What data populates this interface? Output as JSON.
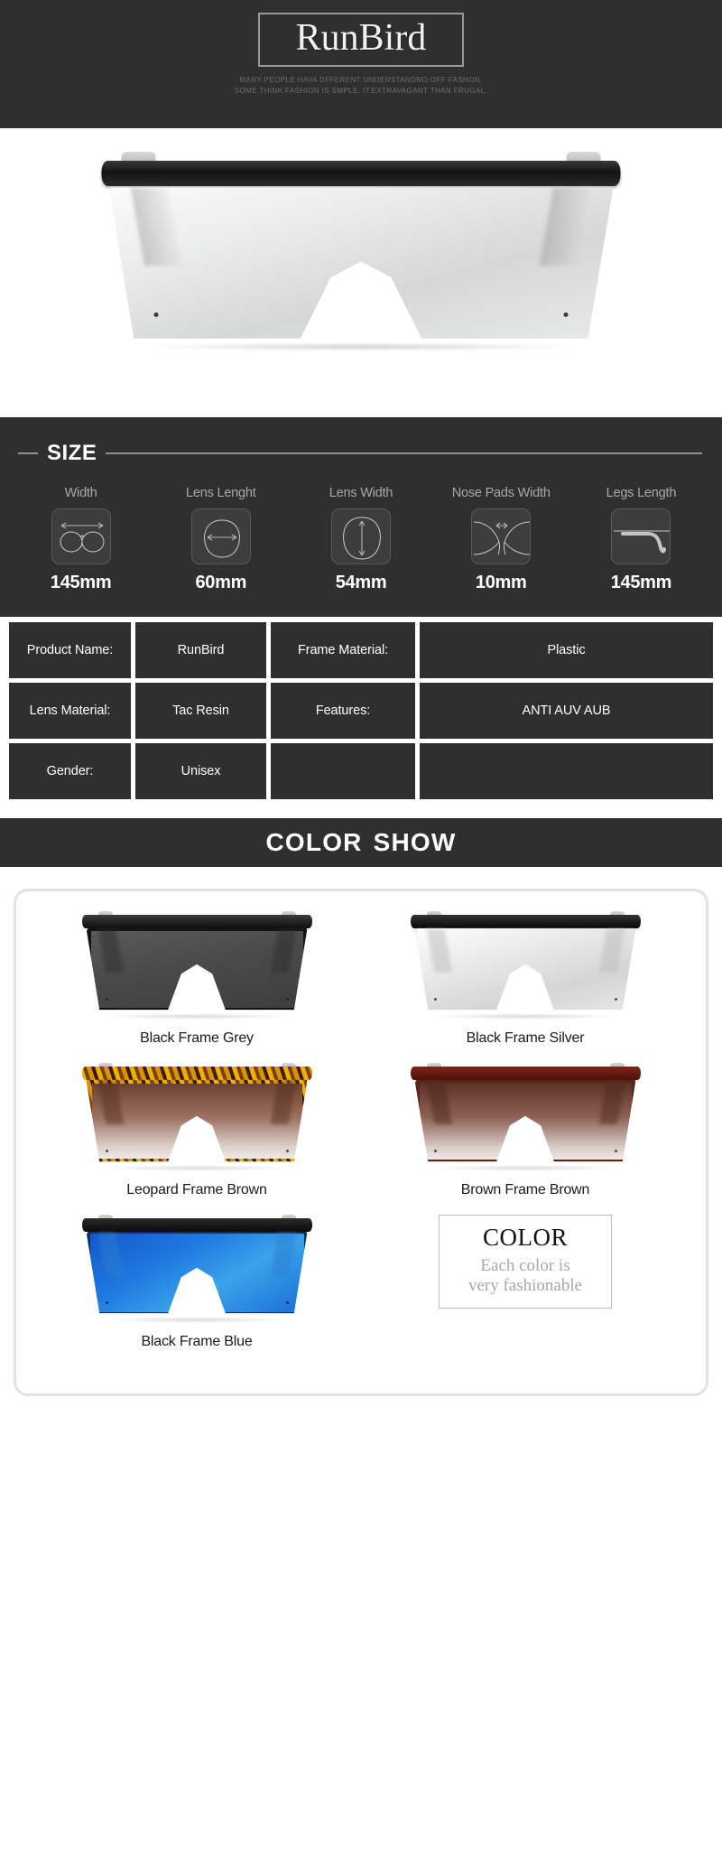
{
  "header": {
    "brand": "RunBird",
    "tagline_line1": "MANY PEOPLE HAVA DFFERENT UNDERSTANDNO OFF FASHON.",
    "tagline_line2": "SOME THINK FASHION IS SMPLE. IT,EXTRAVAGANT THAN FRUGAL.",
    "background_color": "#2f2f2f"
  },
  "hero": {
    "product_alt": "Black frame silver mirrored oversized shield sunglasses"
  },
  "size_section": {
    "title": "SIZE",
    "items": [
      {
        "label": "Width",
        "value": "145mm",
        "icon": "glasses-width-icon"
      },
      {
        "label": "Lens Lenght",
        "value": "60mm",
        "icon": "lens-length-icon"
      },
      {
        "label": "Lens Width",
        "value": "54mm",
        "icon": "lens-width-icon"
      },
      {
        "label": "Nose Pads Width",
        "value": "10mm",
        "icon": "nose-pads-width-icon"
      },
      {
        "label": "Legs Length",
        "value": "145mm",
        "icon": "legs-length-icon"
      }
    ]
  },
  "spec_table": {
    "rows": [
      [
        {
          "text": "Product Name:",
          "type": "label"
        },
        {
          "text": "RunBird",
          "type": "value"
        },
        {
          "text": "Frame Material:",
          "type": "label"
        },
        {
          "text": "Plastic",
          "type": "value"
        }
      ],
      [
        {
          "text": "Lens Material:",
          "type": "label"
        },
        {
          "text": "Tac Resin",
          "type": "value"
        },
        {
          "text": "Features:",
          "type": "label"
        },
        {
          "text": "ANTI AUV AUB",
          "type": "value"
        }
      ],
      [
        {
          "text": "Gender:",
          "type": "label"
        },
        {
          "text": "Unisex",
          "type": "value"
        },
        {
          "text": "",
          "type": "empty"
        },
        {
          "text": "",
          "type": "empty"
        }
      ]
    ]
  },
  "color_show": {
    "banner_word1": "COLOR",
    "banner_word2": "SHOW",
    "variants": [
      {
        "label": "Black Frame Grey",
        "key": "grey",
        "frame_color": "#141414",
        "lens_color": "#4a4a4a"
      },
      {
        "label": "Black Frame Silver",
        "key": "silver",
        "frame_color": "#0d0d0d",
        "lens_color": "#e3e5e5"
      },
      {
        "label": "Leopard Frame Brown",
        "key": "leopard",
        "frame_color": "#d79505",
        "lens_color": "#9d7060"
      },
      {
        "label": "Brown Frame Brown",
        "key": "brown",
        "frame_color": "#5a2318",
        "lens_color": "#8d6255"
      },
      {
        "label": "Black Frame Blue",
        "key": "blue",
        "frame_color": "#10305f",
        "lens_color": "#1f79e0"
      }
    ],
    "badge": {
      "title": "COLOR",
      "subtitle_line1": "Each color is",
      "subtitle_line2": "very fashionable"
    }
  }
}
